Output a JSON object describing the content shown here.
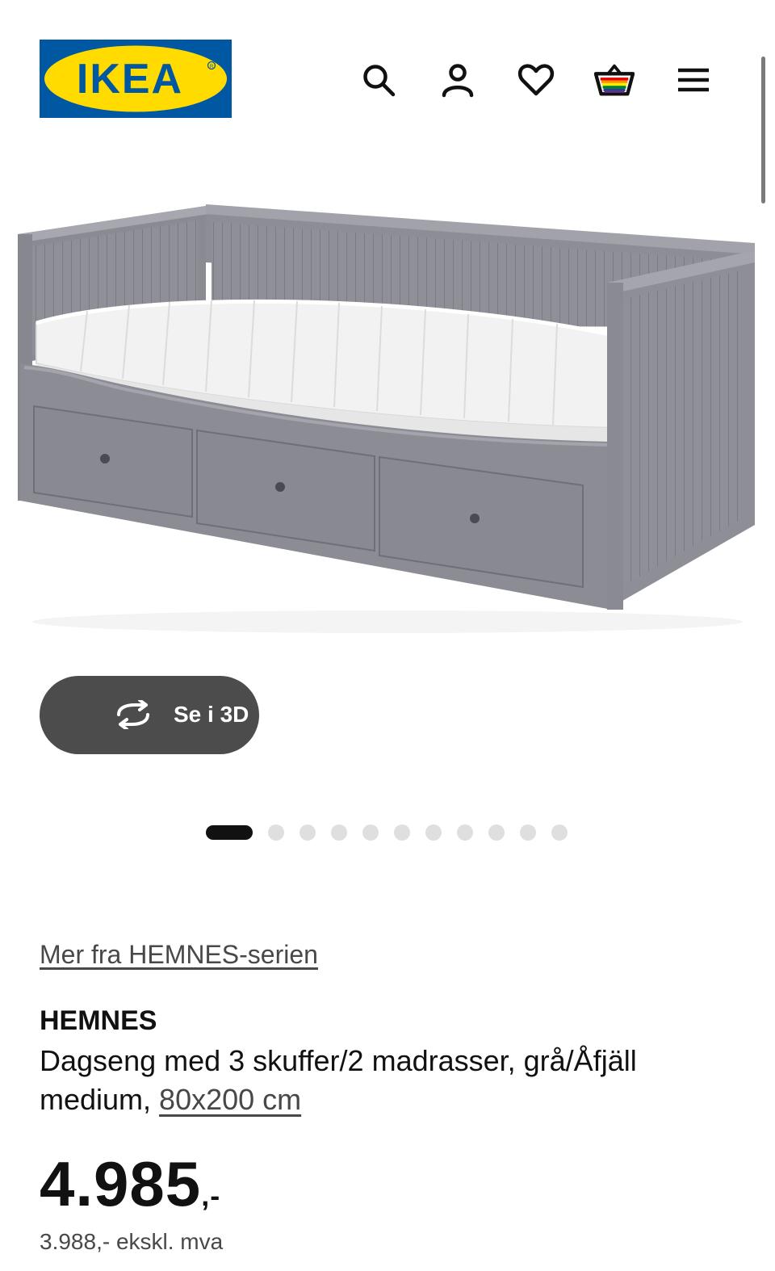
{
  "brand": {
    "logo_text": "IKEA",
    "blue": "#0058a3",
    "yellow": "#ffdb00"
  },
  "header": {
    "icons": [
      "search-icon",
      "account-icon",
      "heart-icon",
      "basket-icon",
      "menu-icon"
    ]
  },
  "product": {
    "view_3d_label": "Se i 3D",
    "gallery": {
      "total": 11,
      "active_index": 0
    },
    "series_link": "Mer fra HEMNES-serien",
    "name": "HEMNES",
    "description": "Dagseng med 3 skuffer/2 madrasser, grå/Åfjäll medium, ",
    "size": "80x200 cm",
    "price": "4.985",
    "price_suffix": ",-",
    "price_ex_vat": "3.988,- ekskl. mva"
  }
}
